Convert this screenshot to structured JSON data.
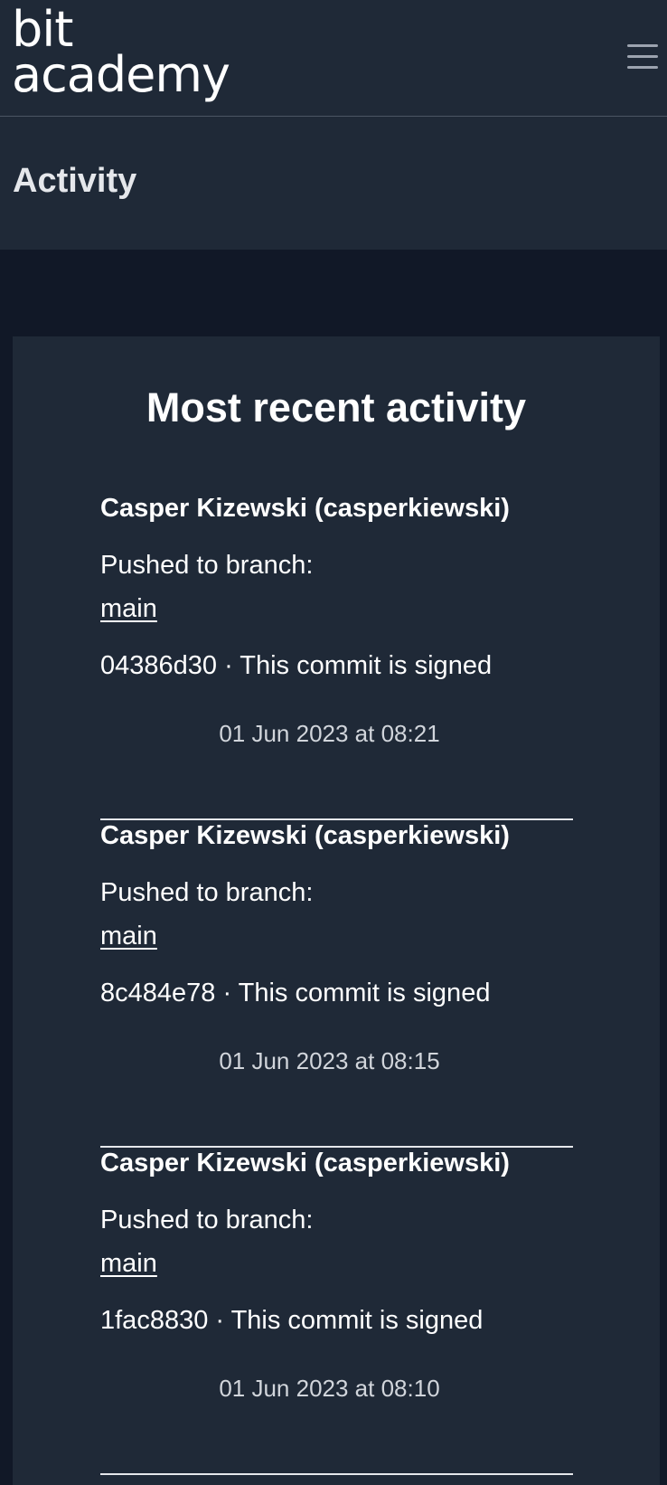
{
  "header": {
    "logo_line1": "bit",
    "logo_line2": "academy"
  },
  "page": {
    "title": "Activity"
  },
  "card": {
    "heading": "Most recent activity"
  },
  "activities": [
    {
      "user": "Casper Kizewski (casperkiewski)",
      "action": "Pushed to branch:",
      "branch": "main",
      "commit": "04386d30 · This commit is signed",
      "time": "01 Jun 2023 at 08:21"
    },
    {
      "user": "Casper Kizewski (casperkiewski)",
      "action": "Pushed to branch:",
      "branch": "main",
      "commit": "8c484e78 · This commit is signed",
      "time": "01 Jun 2023 at 08:15"
    },
    {
      "user": "Casper Kizewski (casperkiewski)",
      "action": "Pushed to branch:",
      "branch": "main",
      "commit": "1fac8830 · This commit is signed",
      "time": "01 Jun 2023 at 08:10"
    }
  ],
  "colors": {
    "background": "#111827",
    "panel": "#1f2937",
    "text": "#ffffff",
    "muted": "#d1d5db"
  }
}
